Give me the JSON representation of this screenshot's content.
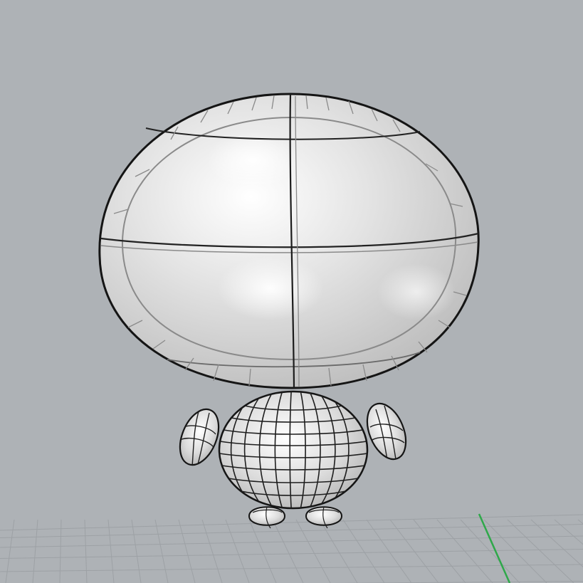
{
  "viewport": {
    "colors": {
      "background": "#aeb2b6",
      "grid_line": "#9da1a5",
      "grid_major": "#8f9498",
      "axis_y": "#2fa84a",
      "surface_light": "#f4f4f4",
      "surface_mid": "#d9d9d9",
      "surface_dark": "#bcbcbc",
      "edge": "#151515",
      "isocurve": "#7a7a7a"
    },
    "objects": [
      {
        "name": "head",
        "kind": "ellipsoid-dome"
      },
      {
        "name": "body",
        "kind": "sphere"
      },
      {
        "name": "left-arm",
        "kind": "ellipsoid"
      },
      {
        "name": "right-arm",
        "kind": "ellipsoid"
      },
      {
        "name": "left-foot",
        "kind": "half-sphere"
      },
      {
        "name": "right-foot",
        "kind": "half-sphere"
      }
    ]
  }
}
